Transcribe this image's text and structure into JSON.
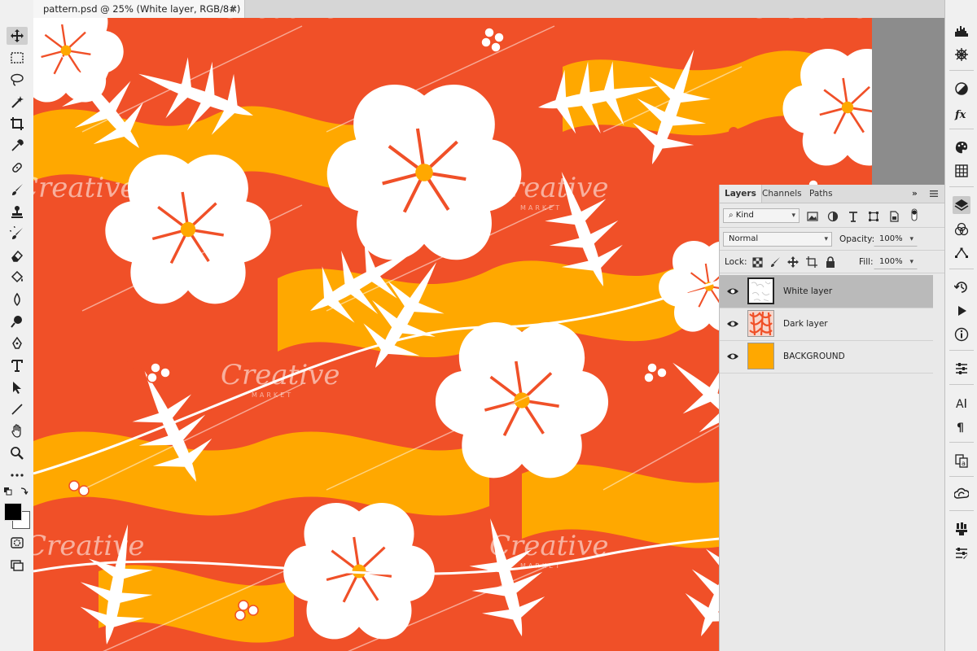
{
  "document": {
    "tab_title": "pattern.psd @ 25% (White layer, RGB/8#)",
    "close_glyph": "×"
  },
  "watermark_text": "Creative",
  "watermark_sub": "MARKET",
  "colors": {
    "orange_red": "#f05028",
    "golden": "#ffa800",
    "white": "#ffffff",
    "selected_layer": "#bababa"
  },
  "left_tools": [
    "move-tool-icon",
    "rectangular-marquee-icon",
    "lasso-icon",
    "magic-wand-icon",
    "crop-icon",
    "eyedropper-icon",
    "spot-healing-icon",
    "brush-icon",
    "clone-stamp-icon",
    "history-brush-icon",
    "eraser-icon",
    "paint-bucket-icon",
    "blur-icon",
    "dodge-icon",
    "pen-icon",
    "type-icon",
    "path-selection-icon",
    "line-icon",
    "hand-icon",
    "zoom-icon",
    "more-tools-icon"
  ],
  "right_panel_icons": [
    "histogram-icon",
    "navigator-icon",
    "adjustments-icon",
    "styles-icon",
    "color-icon",
    "swatches-icon",
    "layers-icon",
    "channels-icon",
    "paths-icon",
    "history-icon",
    "actions-icon",
    "info-icon",
    "properties-icon",
    "character-icon",
    "paragraph-icon",
    "glyphs-icon",
    "libraries-icon",
    "brushes-icon",
    "brush-settings-icon"
  ],
  "layers_panel": {
    "tabs": [
      "Layers",
      "Channels",
      "Paths"
    ],
    "expand_glyph": "»",
    "filter": {
      "kind_label": "Kind",
      "search_glyph": "⌕"
    },
    "blend_mode": "Normal",
    "opacity_label": "Opacity:",
    "opacity_value": "100%",
    "lock_label": "Lock:",
    "fill_label": "Fill:",
    "fill_value": "100%",
    "layers": [
      {
        "name": "White layer",
        "selected": true
      },
      {
        "name": "Dark layer",
        "selected": false
      },
      {
        "name": "BACKGROUND",
        "selected": false
      }
    ]
  }
}
